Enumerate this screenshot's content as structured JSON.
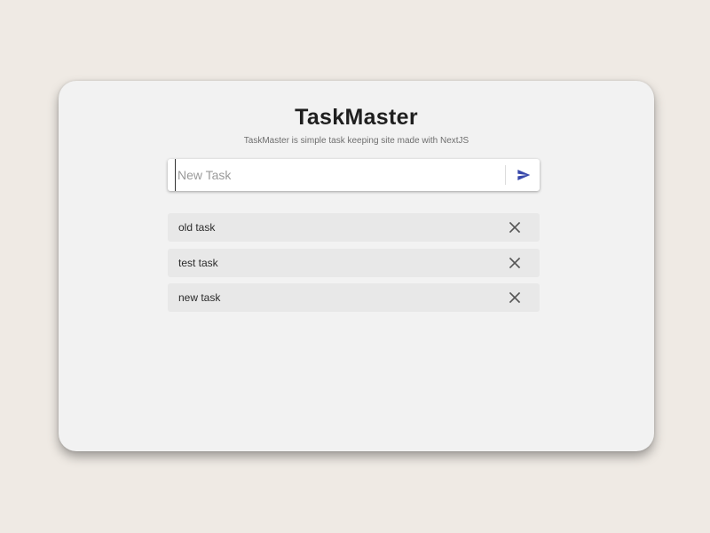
{
  "app": {
    "title": "TaskMaster",
    "subtitle": "TaskMaster is simple task keeping site made with NextJS"
  },
  "input": {
    "placeholder": "New Task",
    "value": "",
    "send_icon": "send-icon"
  },
  "tasks": [
    {
      "label": "old task",
      "action_icon": "close-icon"
    },
    {
      "label": "test task",
      "action_icon": "close-icon"
    },
    {
      "label": "new task",
      "action_icon": "close-icon"
    }
  ],
  "colors": {
    "page_background": "#efeae4",
    "card_background": "#f2f2f2",
    "task_background": "#e8e8e8",
    "accent": "#3949ab"
  }
}
